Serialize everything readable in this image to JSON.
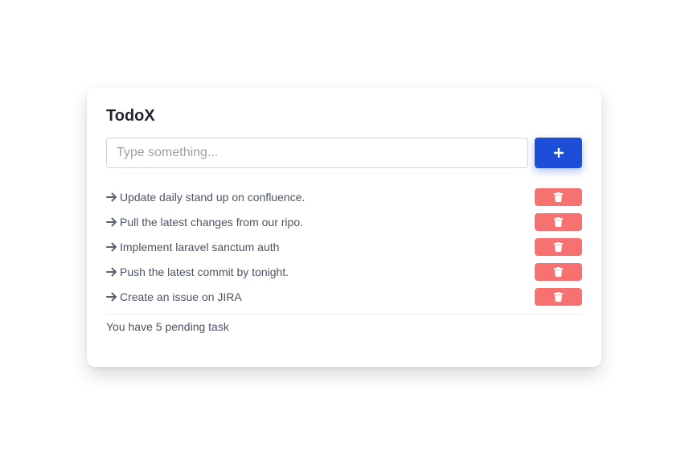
{
  "app": {
    "title": "TodoX"
  },
  "input": {
    "value": "",
    "placeholder": "Type something..."
  },
  "add_button": {
    "icon": "plus-icon"
  },
  "tasks": [
    {
      "text": "Update daily stand up on confluence.",
      "icon": "arrow-right-icon",
      "delete_icon": "trash-icon"
    },
    {
      "text": "Pull the latest changes from our ripo.",
      "icon": "arrow-right-icon",
      "delete_icon": "trash-icon"
    },
    {
      "text": "Implement laravel sanctum auth",
      "icon": "arrow-right-icon",
      "delete_icon": "trash-icon"
    },
    {
      "text": "Push the latest commit by tonight.",
      "icon": "arrow-right-icon",
      "delete_icon": "trash-icon"
    },
    {
      "text": "Create an issue on JIRA",
      "icon": "arrow-right-icon",
      "delete_icon": "trash-icon"
    }
  ],
  "footer": {
    "pending_text": "You have 5 pending task"
  },
  "colors": {
    "primary": "#1d4ed8",
    "danger": "#f87171",
    "text": "#4b5563",
    "title": "#1f2430"
  }
}
